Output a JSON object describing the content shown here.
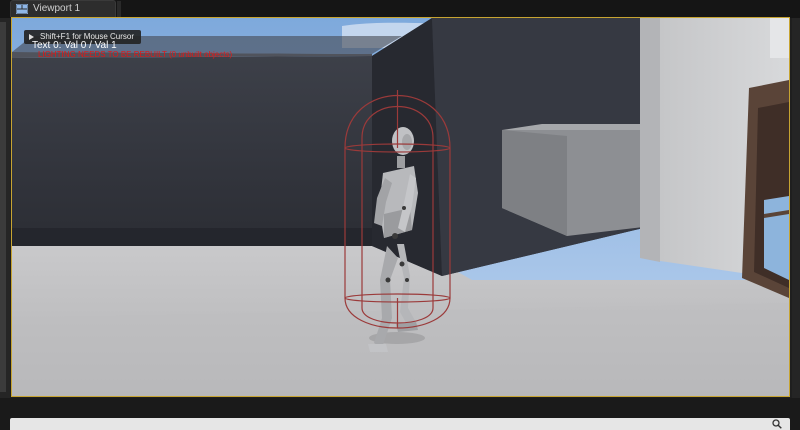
{
  "tabs": [
    {
      "label": "Viewport 1"
    }
  ],
  "viewport": {
    "hint_text": "Shift+F1 for Mouse Cursor",
    "debug_text": "Text 0:  Val 0 / Val 1",
    "warning_text": "LIGHTING NEEDS TO BE REBUILT (0 unbuilt objects)",
    "colors": {
      "focus_border": "#c7a431",
      "warning": "#e01818",
      "capsule": "#9b3a3a"
    }
  },
  "icons": {
    "tab": "viewport-layout-icon",
    "hint": "play-arrow-icon",
    "search": "search-icon"
  }
}
